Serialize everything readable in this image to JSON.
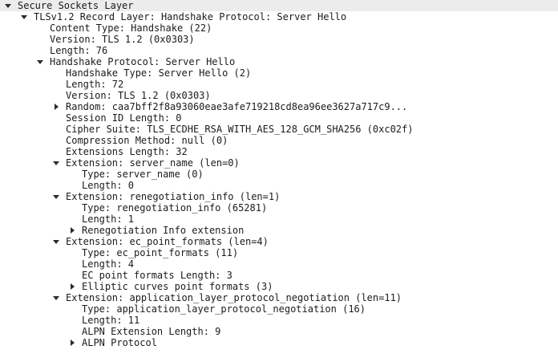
{
  "packet_details": {
    "rows": [
      {
        "text": "Secure Sockets Layer",
        "level": 0,
        "toggle": "open"
      },
      {
        "text": "TLSv1.2 Record Layer: Handshake Protocol: Server Hello",
        "level": 1,
        "toggle": "open"
      },
      {
        "text": "Content Type: Handshake (22)",
        "level": 2,
        "toggle": "none"
      },
      {
        "text": "Version: TLS 1.2 (0x0303)",
        "level": 2,
        "toggle": "none"
      },
      {
        "text": "Length: 76",
        "level": 2,
        "toggle": "none"
      },
      {
        "text": "Handshake Protocol: Server Hello",
        "level": 2,
        "toggle": "open"
      },
      {
        "text": "Handshake Type: Server Hello (2)",
        "level": 3,
        "toggle": "none"
      },
      {
        "text": "Length: 72",
        "level": 3,
        "toggle": "none"
      },
      {
        "text": "Version: TLS 1.2 (0x0303)",
        "level": 3,
        "toggle": "none"
      },
      {
        "text": "Random: caa7bff2f8a93060eae3afe719218cd8ea96ee3627a717c9...",
        "level": 3,
        "toggle": "closed"
      },
      {
        "text": "Session ID Length: 0",
        "level": 3,
        "toggle": "none"
      },
      {
        "text": "Cipher Suite: TLS_ECDHE_RSA_WITH_AES_128_GCM_SHA256 (0xc02f)",
        "level": 3,
        "toggle": "none"
      },
      {
        "text": "Compression Method: null (0)",
        "level": 3,
        "toggle": "none"
      },
      {
        "text": "Extensions Length: 32",
        "level": 3,
        "toggle": "none"
      },
      {
        "text": "Extension: server_name (len=0)",
        "level": 3,
        "toggle": "open"
      },
      {
        "text": "Type: server_name (0)",
        "level": 4,
        "toggle": "none"
      },
      {
        "text": "Length: 0",
        "level": 4,
        "toggle": "none"
      },
      {
        "text": "Extension: renegotiation_info (len=1)",
        "level": 3,
        "toggle": "open"
      },
      {
        "text": "Type: renegotiation_info (65281)",
        "level": 4,
        "toggle": "none"
      },
      {
        "text": "Length: 1",
        "level": 4,
        "toggle": "none"
      },
      {
        "text": "Renegotiation Info extension",
        "level": 4,
        "toggle": "closed"
      },
      {
        "text": "Extension: ec_point_formats (len=4)",
        "level": 3,
        "toggle": "open"
      },
      {
        "text": "Type: ec_point_formats (11)",
        "level": 4,
        "toggle": "none"
      },
      {
        "text": "Length: 4",
        "level": 4,
        "toggle": "none"
      },
      {
        "text": "EC point formats Length: 3",
        "level": 4,
        "toggle": "none"
      },
      {
        "text": "Elliptic curves point formats (3)",
        "level": 4,
        "toggle": "closed"
      },
      {
        "text": "Extension: application_layer_protocol_negotiation (len=11)",
        "level": 3,
        "toggle": "open"
      },
      {
        "text": "Type: application_layer_protocol_negotiation (16)",
        "level": 4,
        "toggle": "none"
      },
      {
        "text": "Length: 11",
        "level": 4,
        "toggle": "none"
      },
      {
        "text": "ALPN Extension Length: 9",
        "level": 4,
        "toggle": "none"
      },
      {
        "text": "ALPN Protocol",
        "level": 4,
        "toggle": "closed"
      }
    ]
  }
}
